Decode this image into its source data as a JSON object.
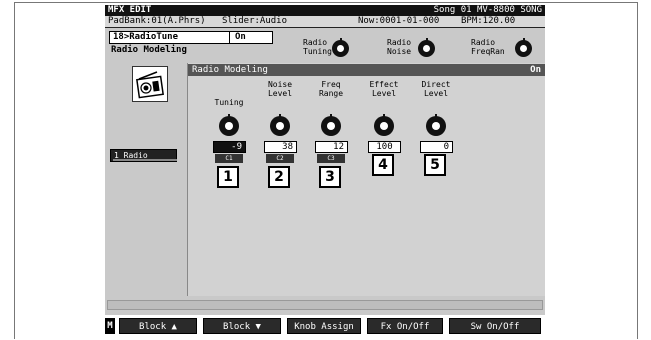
{
  "title_bar": {
    "left": "MFX EDIT",
    "right": "Song 01 MV-8800 SONG"
  },
  "info_bar": {
    "padbank": "PadBank:01(A.Phrs)",
    "slider": "Slider:Audio",
    "now": "Now:0001-01-000",
    "bpm": "BPM:120.00"
  },
  "patch": {
    "number_name": "18>RadioTune",
    "state": "On",
    "type_name": "Radio Modeling"
  },
  "header_knobs": [
    {
      "label": "Radio\nTuning"
    },
    {
      "label": "Radio\nNoise"
    },
    {
      "label": "Radio\nFreqRan"
    }
  ],
  "sidebar": {
    "icon": "radio-icon",
    "selected_item": "1 Radio"
  },
  "panel": {
    "title": "Radio Modeling",
    "state": "On"
  },
  "params": [
    {
      "label": "Tuning",
      "value": "-9",
      "ctrl": "C1",
      "num": "1",
      "highlight": true
    },
    {
      "label": "Noise\nLevel",
      "value": "38",
      "ctrl": "C2",
      "num": "2",
      "highlight": false
    },
    {
      "label": "Freq\nRange",
      "value": "12",
      "ctrl": "C3",
      "num": "3",
      "highlight": false
    },
    {
      "label": "Effect\nLevel",
      "value": "100",
      "ctrl": "",
      "num": "4",
      "highlight": false
    },
    {
      "label": "Direct\nLevel",
      "value": "0",
      "ctrl": "",
      "num": "5",
      "highlight": false
    }
  ],
  "function_bar": {
    "m": "M",
    "f1": "Block ▲",
    "f2": "Block ▼",
    "f3": "Knob Assign",
    "f4": "Fx On/Off",
    "f5": "Sw On/Off"
  }
}
